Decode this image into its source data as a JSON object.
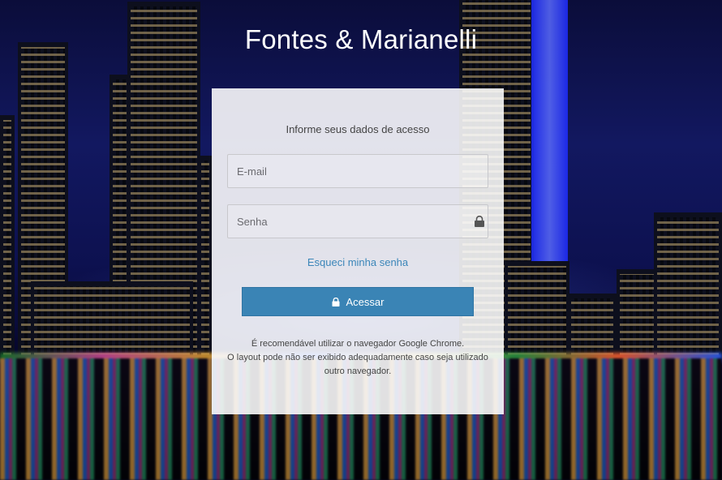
{
  "brand": {
    "title": "Fontes & Marianelli"
  },
  "login": {
    "heading": "Informe seus dados de acesso",
    "email_placeholder": "E-mail",
    "password_placeholder": "Senha",
    "forgot_label": "Esqueci minha senha",
    "submit_label": "Acessar"
  },
  "notice": {
    "line1": "É recomendável utilizar o navegador Google Chrome.",
    "line2": "O layout pode não ser exibido adequadamente caso seja utilizado",
    "line3": "outro navegador."
  },
  "icons": {
    "password_field": "lock-icon",
    "submit_button": "lock-icon"
  },
  "colors": {
    "accent": "#3a84b5",
    "link": "#3b86b9"
  }
}
